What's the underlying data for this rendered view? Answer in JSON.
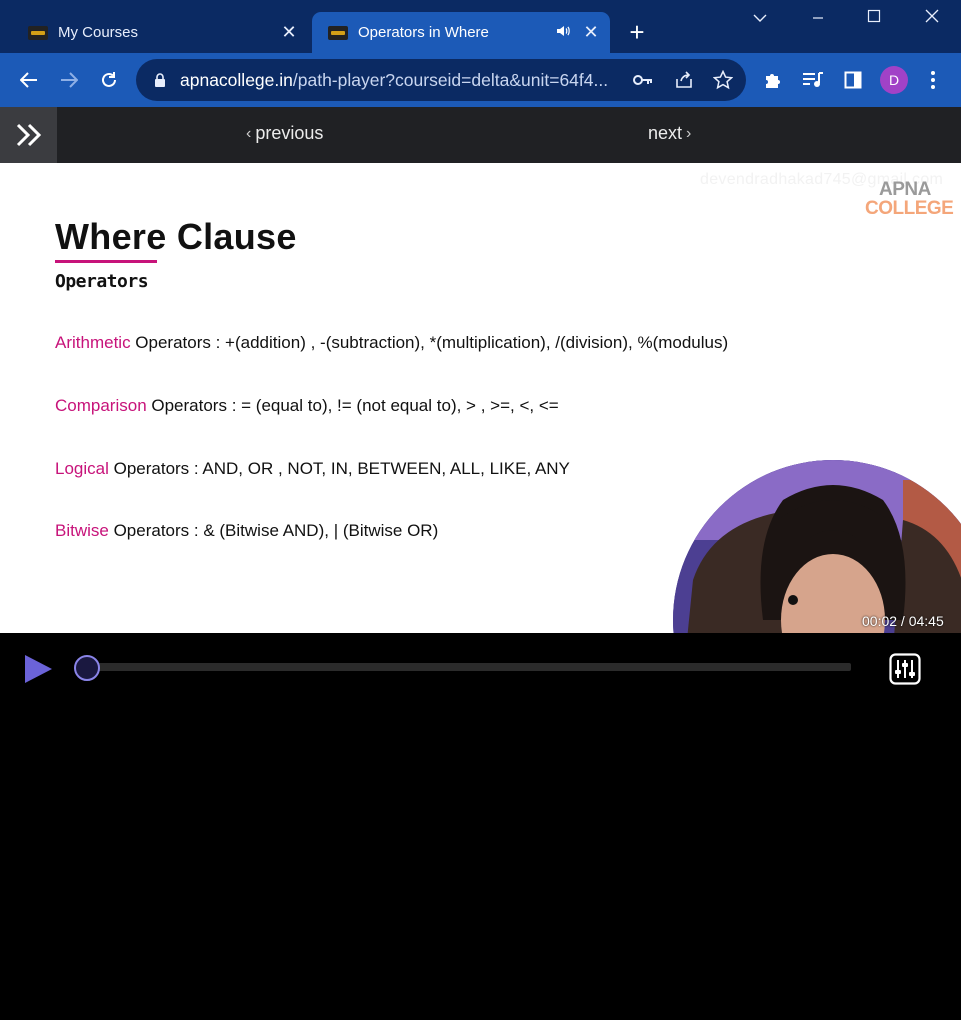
{
  "tabs": [
    {
      "title": "My Courses",
      "active": false
    },
    {
      "title": "Operators in Where",
      "active": true,
      "audio": true
    }
  ],
  "toolbar": {
    "url_host": "apnacollege.in",
    "url_rest": "/path-player?courseid=delta&unit=64f4...",
    "profile_initial": "D",
    "avatar_color": "#a142c7"
  },
  "player_nav": {
    "previous_label": "previous",
    "next_label": "next"
  },
  "slide": {
    "watermark": "devendradhakad745@gmail.com",
    "logo_line1": "APNA",
    "logo_line2": "COLLEGE",
    "title": "Where Clause",
    "subtitle": "Operators",
    "accent_color": "#c7137a",
    "operators": [
      {
        "keyword": "Arithmetic",
        "text": " Operators : +(addition) , -(subtraction), *(multiplication), /(division), %(modulus)"
      },
      {
        "keyword": "Comparison",
        "text": " Operators : = (equal to), != (not equal to), > , >=, <, <="
      },
      {
        "keyword": "Logical",
        "text": " Operators : AND, OR , NOT, IN, BETWEEN, ALL, LIKE, ANY"
      },
      {
        "keyword": "Bitwise",
        "text": " Operators : & (Bitwise AND), | (Bitwise OR)"
      }
    ]
  },
  "video": {
    "time_display": "00:02 / 04:45",
    "progress_fraction": 0.007,
    "accent_color": "#6b63d8"
  }
}
